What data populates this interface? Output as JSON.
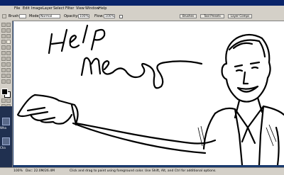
{
  "menubar": {
    "items": [
      "File",
      "Edit",
      "Image",
      "Layer",
      "Select",
      "Filter",
      "View",
      "Window",
      "Help"
    ]
  },
  "options": {
    "mode_label": "Mode:",
    "mode_value": "Normal",
    "opacity_label": "Opacity:",
    "opacity_value": "100%",
    "flow_label": "Flow:",
    "flow_value": "100%"
  },
  "palettes": {
    "tabs": [
      "Brushes",
      "Tool Presets",
      "Layer Comps"
    ]
  },
  "statusbar": {
    "zoom": "100%",
    "doc_info": "Doc: 22.0M/26.4M",
    "hint": "Click and drag to paint using foreground color. Use Shift, Alt, and Ctrl for additional options."
  },
  "drawing": {
    "text": "Help me"
  },
  "taskbar_labels": [
    "Wha",
    "Cha"
  ]
}
